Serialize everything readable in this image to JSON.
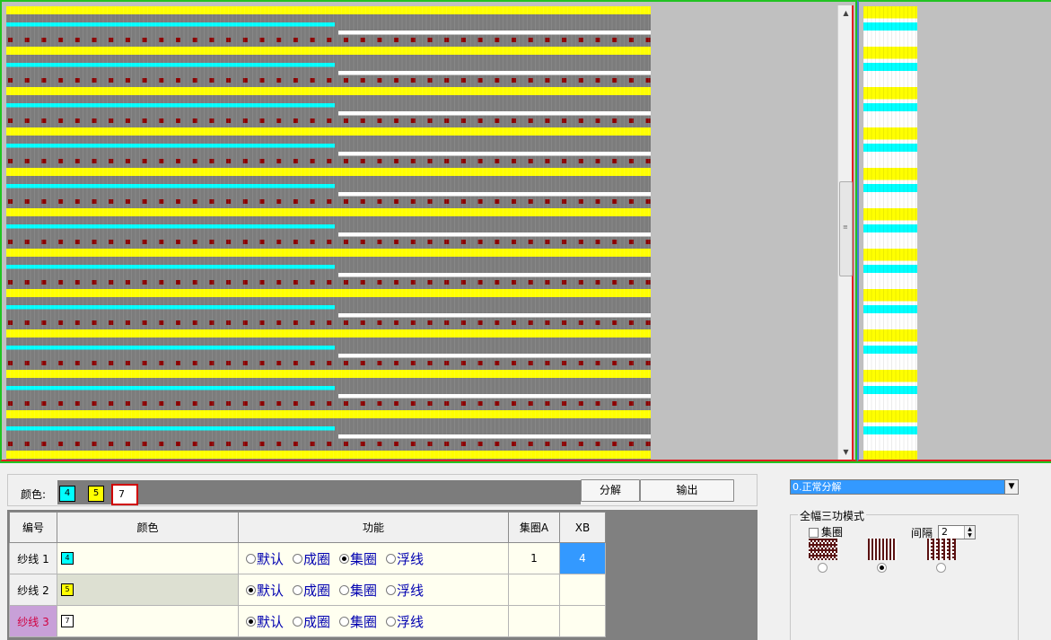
{
  "colors": {
    "cyan": "#00ffff",
    "yellow": "#ffff00",
    "white": "#ffffff",
    "grid_grey": "#7c7c7c",
    "dot_red": "#8b0000",
    "selected_blue": "#3399ff"
  },
  "color_bar": {
    "label": "颜色:",
    "swatches": [
      "4",
      "5",
      "7"
    ],
    "decompose_button": "分解",
    "output_button": "输出"
  },
  "table": {
    "headers": [
      "编号",
      "颜色",
      "功能",
      "集圈A",
      "XB"
    ],
    "function_options": [
      "默认",
      "成圈",
      "集圈",
      "浮线"
    ],
    "rows": [
      {
        "id": "纱线 1",
        "color": "4",
        "selected_function": 2,
        "jiquan_a": "1",
        "xb": "4"
      },
      {
        "id": "纱线 2",
        "color": "5",
        "selected_function": 0,
        "jiquan_a": "",
        "xb": ""
      },
      {
        "id": "纱线 3",
        "color": "7",
        "selected_function": 0,
        "jiquan_a": "",
        "xb": ""
      }
    ]
  },
  "mode_select": {
    "value": "0.正常分解"
  },
  "mode_group": {
    "title": "全幅三功模式",
    "checkbox_label": "集圈",
    "interval_label": "间隔",
    "interval_value": "2",
    "selected_pattern": 1
  }
}
